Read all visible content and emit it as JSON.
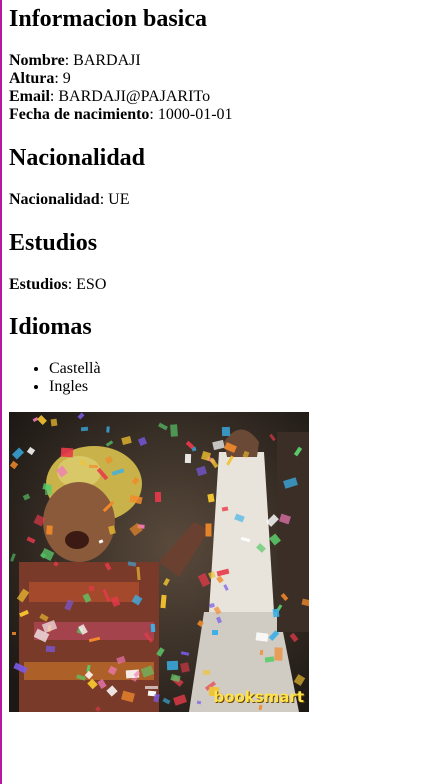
{
  "basic_info": {
    "heading": "Informacion basica",
    "fields": [
      {
        "label": "Nombre",
        "value": "BARDAJI"
      },
      {
        "label": "Altura",
        "value": "9"
      },
      {
        "label": "Email",
        "value": "BARDAJI@PAJARITo"
      },
      {
        "label": "Fecha de nacimiento",
        "value": "1000-01-01"
      }
    ]
  },
  "nationality": {
    "heading": "Nacionalidad",
    "label": "Nacionalidad",
    "value": "UE"
  },
  "studies": {
    "heading": "Estudios",
    "label": "Estudios",
    "value": "ESO"
  },
  "languages": {
    "heading": "Idiomas",
    "items": [
      "Castellà",
      "Ingles"
    ]
  },
  "image": {
    "caption": "booksmart"
  },
  "colors": {
    "left_border": "#b5179e",
    "caption": "#ffe24a"
  }
}
